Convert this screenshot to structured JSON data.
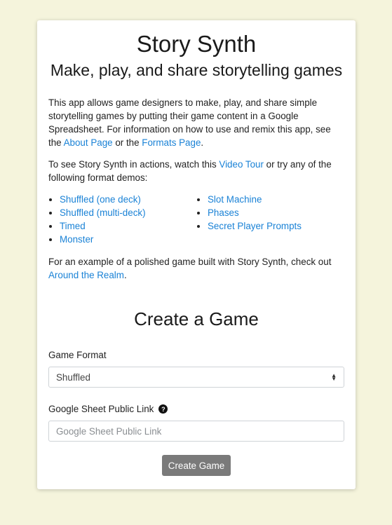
{
  "header": {
    "title": "Story Synth",
    "subtitle": "Make, play, and share storytelling games"
  },
  "intro": {
    "text_before_about": "This app allows game designers to make, play, and share simple storytelling games by putting their game content in a Google Spreadsheet. For information on how to use and remix this app, see the ",
    "about_link": "About Page",
    "text_between": " or the ",
    "formats_link": "Formats Page",
    "text_end": "."
  },
  "demos": {
    "text_before_tour": "To see Story Synth in actions, watch this ",
    "video_tour_link": "Video Tour",
    "text_after_tour": " or try any of the following format demos:",
    "left": [
      "Shuffled (one deck)",
      "Shuffled (multi-deck)",
      "Timed",
      "Monster"
    ],
    "right": [
      "Slot Machine",
      "Phases",
      "Secret Player Prompts"
    ]
  },
  "polished": {
    "text_before": "For an example of a polished game built with Story Synth, check out ",
    "link": "Around the Realm",
    "text_after": "."
  },
  "create": {
    "heading": "Create a Game",
    "format_label": "Game Format",
    "format_value": "Shuffled",
    "sheet_label": "Google Sheet Public Link",
    "sheet_placeholder": "Google Sheet Public Link",
    "help_icon_glyph": "?",
    "button_label": "Create Game"
  },
  "colors": {
    "background": "#f5f4dc",
    "link": "#1a82d6",
    "button": "#7a7a7a"
  }
}
